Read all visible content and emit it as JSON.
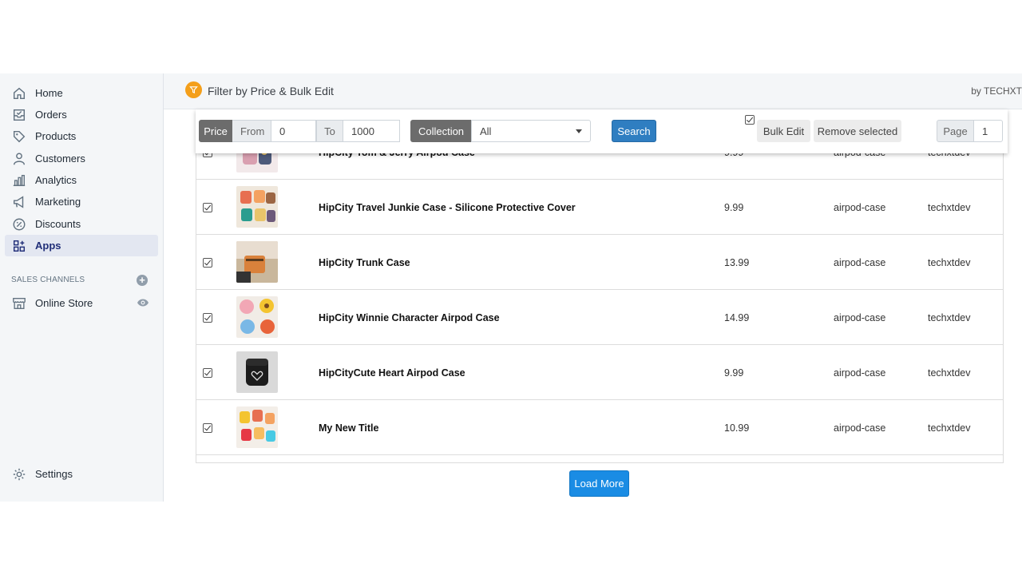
{
  "sidebar": {
    "items": [
      {
        "label": "Home",
        "icon": "home-icon"
      },
      {
        "label": "Orders",
        "icon": "orders-icon"
      },
      {
        "label": "Products",
        "icon": "tag-icon"
      },
      {
        "label": "Customers",
        "icon": "person-icon"
      },
      {
        "label": "Analytics",
        "icon": "bar-chart-icon"
      },
      {
        "label": "Marketing",
        "icon": "megaphone-icon"
      },
      {
        "label": "Discounts",
        "icon": "discount-icon"
      },
      {
        "label": "Apps",
        "icon": "apps-icon",
        "active": true
      }
    ],
    "sales_channels_title": "SALES CHANNELS",
    "online_store": "Online Store",
    "settings": "Settings"
  },
  "app": {
    "title": "Filter by Price & Bulk Edit",
    "by": "by TECHXT"
  },
  "toolbar": {
    "price_label": "Price",
    "from_label": "From",
    "from_value": "0",
    "to_label": "To",
    "to_value": "1000",
    "collection_label": "Collection",
    "collection_value": "All",
    "search_label": "Search",
    "bulk_edit_label": "Bulk Edit",
    "remove_selected_label": "Remove selected",
    "page_label": "Page",
    "page_value": "1"
  },
  "products": [
    {
      "title": "HipCity Tom & Jerry Airpod Case",
      "price": "9.99",
      "collection": "airpod-case",
      "vendor": "techxtdev"
    },
    {
      "title": "HipCity Travel Junkie Case - Silicone Protective Cover",
      "price": "9.99",
      "collection": "airpod-case",
      "vendor": "techxtdev"
    },
    {
      "title": "HipCity Trunk Case",
      "price": "13.99",
      "collection": "airpod-case",
      "vendor": "techxtdev"
    },
    {
      "title": "HipCity Winnie Character Airpod Case",
      "price": "14.99",
      "collection": "airpod-case",
      "vendor": "techxtdev"
    },
    {
      "title": "HipCityCute Heart Airpod Case",
      "price": "9.99",
      "collection": "airpod-case",
      "vendor": "techxtdev"
    },
    {
      "title": "My New Title",
      "price": "10.99",
      "collection": "airpod-case",
      "vendor": "techxtdev"
    }
  ],
  "load_more_label": "Load More",
  "colors": {
    "accent": "#2f7ec1",
    "load_more": "#1a8ce4",
    "app_logo": "#f49f1a",
    "active_nav": "#202e78"
  }
}
